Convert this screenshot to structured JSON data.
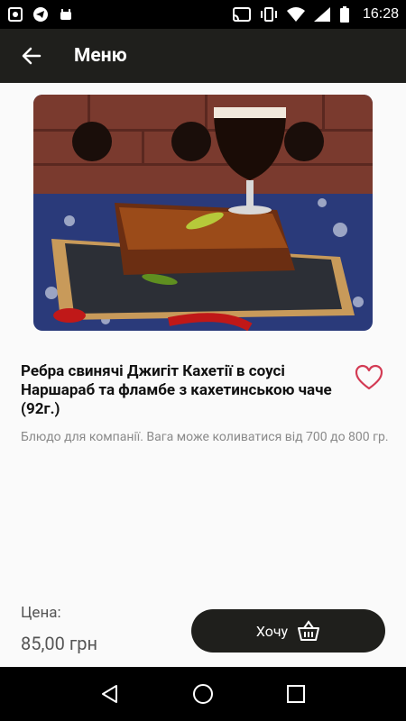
{
  "status_bar": {
    "time": "16:28"
  },
  "app_bar": {
    "title": "Меню"
  },
  "product": {
    "name": "Ребра свинячі Джигіт Кахетії в соусі Наршараб та фламбе з кахетинською чаче (92г.)",
    "description": "Блюдо для компанії. Вага може коливатися  від 700 до 800 гр.",
    "price_label": "Цена:",
    "price": "85,00 грн",
    "buy_label": "Хочу"
  },
  "colors": {
    "bar": "#1f1f1c",
    "accent_heart": "#d33b54"
  }
}
